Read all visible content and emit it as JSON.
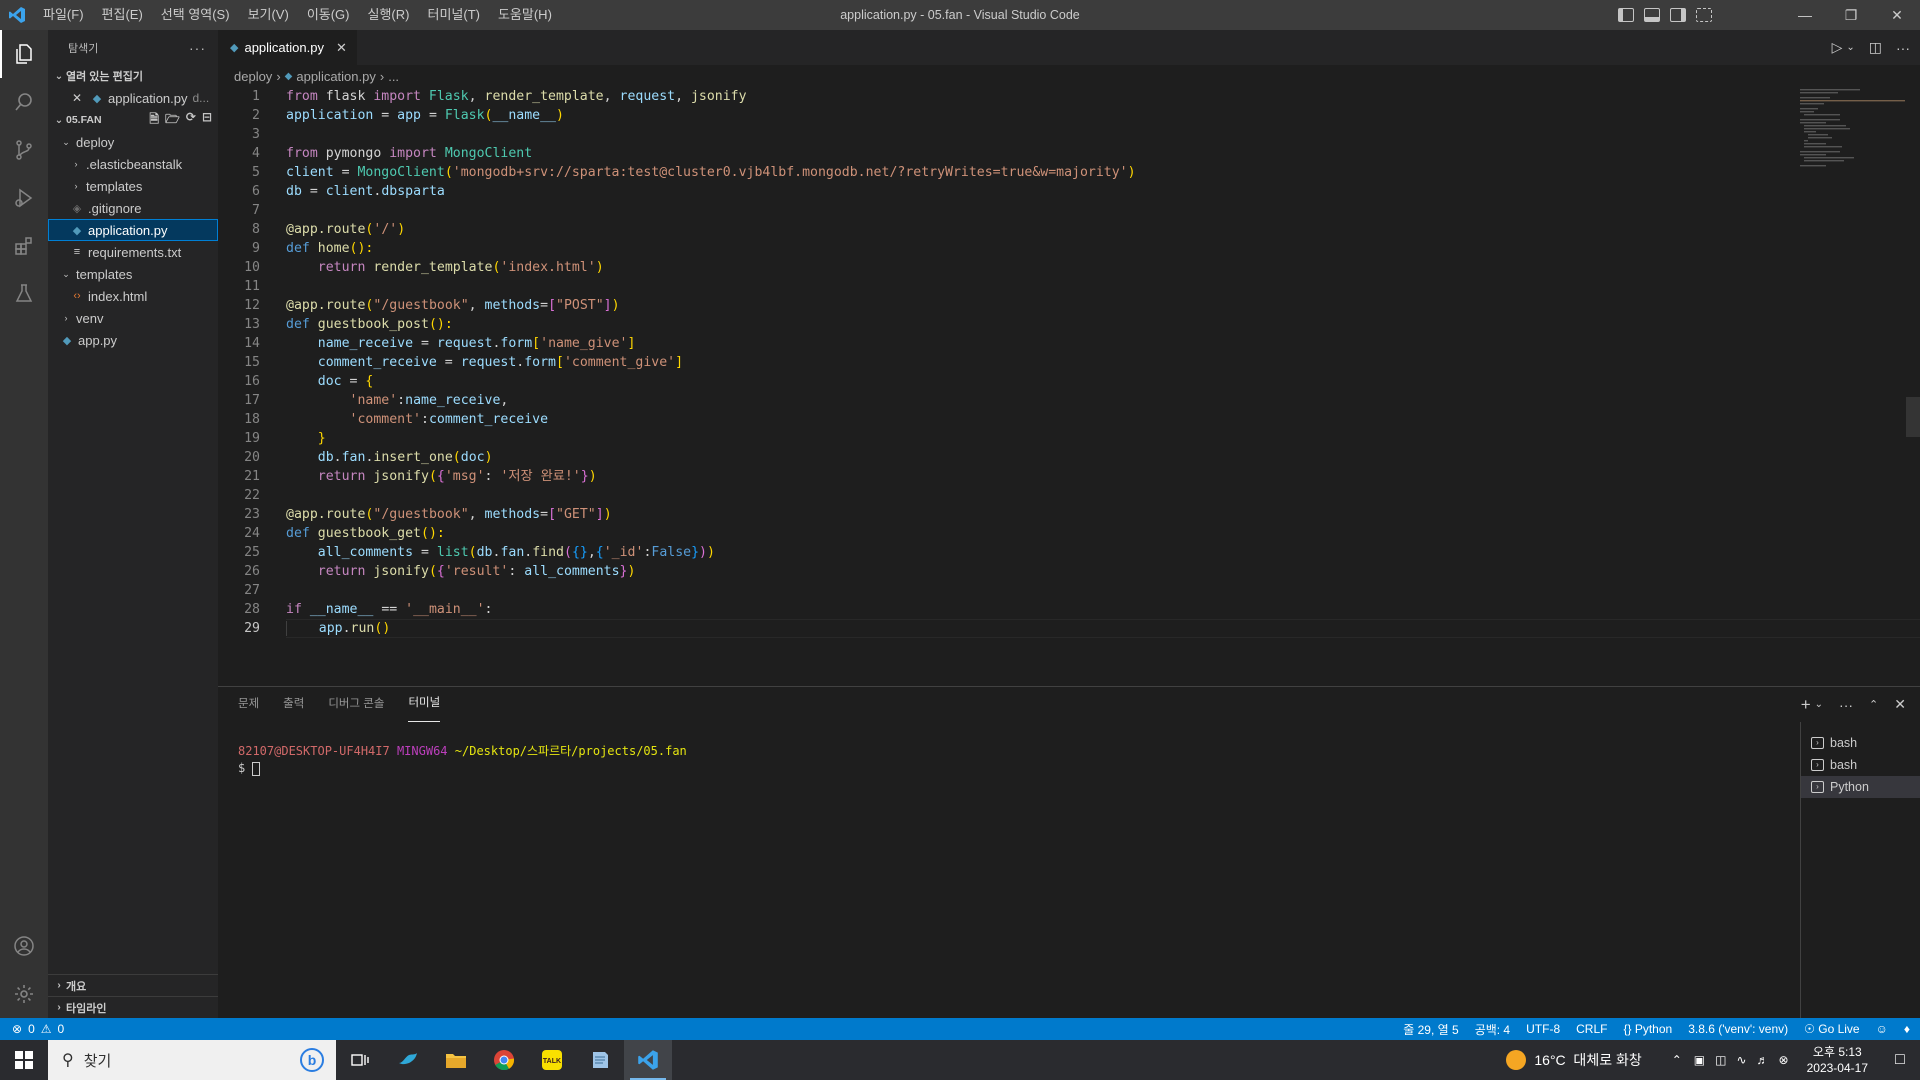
{
  "window": {
    "title": "application.py - 05.fan - Visual Studio Code"
  },
  "menu": [
    "파일(F)",
    "편집(E)",
    "선택 영역(S)",
    "보기(V)",
    "이동(G)",
    "실행(R)",
    "터미널(T)",
    "도움말(H)"
  ],
  "sidebar": {
    "title": "탐색기",
    "open_editors": {
      "label": "열려 있는 편집기",
      "item": "application.py",
      "item_suffix": "d..."
    },
    "folder": {
      "label": "05.FAN"
    },
    "tree": [
      {
        "label": "deploy",
        "type": "folder-open",
        "depth": 1
      },
      {
        "label": ".elasticbeanstalk",
        "type": "folder",
        "depth": 2
      },
      {
        "label": "templates",
        "type": "folder",
        "depth": 2
      },
      {
        "label": ".gitignore",
        "type": "git",
        "depth": 2
      },
      {
        "label": "application.py",
        "type": "py",
        "depth": 2,
        "selected": true
      },
      {
        "label": "requirements.txt",
        "type": "txt",
        "depth": 2
      },
      {
        "label": "templates",
        "type": "folder-open",
        "depth": 1
      },
      {
        "label": "index.html",
        "type": "html",
        "depth": 2
      },
      {
        "label": "venv",
        "type": "folder",
        "depth": 1
      },
      {
        "label": "app.py",
        "type": "py",
        "depth": 1
      }
    ],
    "outline": "개요",
    "timeline": "타임라인"
  },
  "editor": {
    "tab": "application.py",
    "breadcrumb": [
      "deploy",
      "application.py",
      "..."
    ],
    "line_numbers": [
      "1",
      "2",
      "3",
      "4",
      "5",
      "6",
      "7",
      "8",
      "9",
      "10",
      "11",
      "12",
      "13",
      "14",
      "15",
      "16",
      "17",
      "18",
      "19",
      "20",
      "21",
      "22",
      "23",
      "24",
      "25",
      "26",
      "27",
      "28",
      "29"
    ],
    "code": {
      "l1": [
        "from",
        " flask ",
        "import",
        " Flask",
        ", ",
        "render_template",
        ", ",
        "request",
        ", ",
        "jsonify"
      ],
      "l2": [
        "application",
        " = ",
        "app",
        " = ",
        "Flask",
        "(",
        "__name__",
        ")"
      ],
      "l4": [
        "from",
        " pymongo ",
        "import",
        " MongoClient"
      ],
      "l5": [
        "client",
        " = ",
        "MongoClient",
        "(",
        "'mongodb+srv://sparta:test@cluster0.vjb4lbf.mongodb.net/?retryWrites=true&w=majority'",
        ")"
      ],
      "l6": [
        "db",
        " = ",
        "client",
        ".",
        "dbsparta"
      ],
      "l8": [
        "@app",
        ".",
        "route",
        "(",
        "'/'",
        ")"
      ],
      "l9": [
        "def",
        " ",
        "home",
        "():"
      ],
      "l10": [
        "    ",
        "return",
        " ",
        "render_template",
        "(",
        "'index.html'",
        ")"
      ],
      "l12": [
        "@app",
        ".",
        "route",
        "(",
        "\"/guestbook\"",
        ", ",
        "methods",
        "=",
        "[",
        "\"POST\"",
        "]",
        ")"
      ],
      "l13": [
        "def",
        " ",
        "guestbook_post",
        "():"
      ],
      "l14": [
        "    ",
        "name_receive",
        " = ",
        "request",
        ".",
        "form",
        "[",
        "'name_give'",
        "]"
      ],
      "l15": [
        "    ",
        "comment_receive",
        " = ",
        "request",
        ".",
        "form",
        "[",
        "'comment_give'",
        "]"
      ],
      "l16": [
        "    ",
        "doc",
        " = ",
        "{"
      ],
      "l17": [
        "        ",
        "'name'",
        ":",
        "name_receive",
        ","
      ],
      "l18": [
        "        ",
        "'comment'",
        ":",
        "comment_receive"
      ],
      "l19": [
        "    ",
        "}"
      ],
      "l20": [
        "    ",
        "db",
        ".",
        "fan",
        ".",
        "insert_one",
        "(",
        "doc",
        ")"
      ],
      "l21": [
        "    ",
        "return",
        " ",
        "jsonify",
        "(",
        "{",
        "'msg'",
        ": ",
        "'저장 완료!'",
        "}",
        ")"
      ],
      "l23": [
        "@app",
        ".",
        "route",
        "(",
        "\"/guestbook\"",
        ", ",
        "methods",
        "=",
        "[",
        "\"GET\"",
        "]",
        ")"
      ],
      "l24": [
        "def",
        " ",
        "guestbook_get",
        "():"
      ],
      "l25": [
        "    ",
        "all_comments",
        " = ",
        "list",
        "(",
        "db",
        ".",
        "fan",
        ".",
        "find",
        "(",
        "{}",
        ",",
        "{",
        "'_id'",
        ":",
        "False",
        "}",
        ")",
        ")"
      ],
      "l26": [
        "    ",
        "return",
        " ",
        "jsonify",
        "(",
        "{",
        "'result'",
        ": ",
        "all_comments",
        "}",
        ")"
      ],
      "l28": [
        "if",
        " ",
        "__name__",
        " == ",
        "'__main__'",
        ":"
      ],
      "l29": [
        "    ",
        "app",
        ".",
        "run",
        "()"
      ]
    }
  },
  "panel": {
    "tabs": [
      "문제",
      "출력",
      "디버그 콘솔",
      "터미널"
    ],
    "active_tab": "터미널",
    "terminal": {
      "user": "82107@DESKTOP-UF4H4I7",
      "system": "MINGW64",
      "path": "~/Desktop/스파르타/projects/05.fan",
      "prompt": "$ "
    },
    "terminals": [
      "bash",
      "bash",
      "Python"
    ]
  },
  "statusbar": {
    "errors": "0",
    "warnings": "0",
    "position": "줄 29, 열 5",
    "spaces": "공백: 4",
    "encoding": "UTF-8",
    "eol": "CRLF",
    "language": "Python",
    "interpreter": "3.8.6 ('venv': venv)",
    "golive": "Go Live"
  },
  "taskbar": {
    "search_placeholder": "찾기",
    "weather": "16°C  대체로 화창",
    "time": "오후 5:13",
    "date": "2023-04-17"
  },
  "colors": {
    "accent": "#007acc",
    "background": "#1e1e1e",
    "sidebar": "#252526",
    "activitybar": "#333333"
  }
}
